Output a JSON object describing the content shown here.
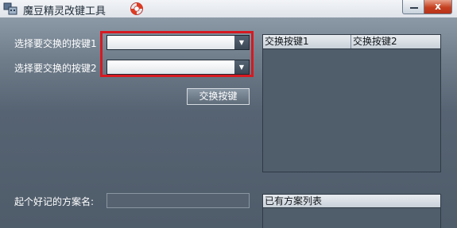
{
  "window": {
    "title": "魔豆精灵改键工具",
    "close_label": "x"
  },
  "form": {
    "key1_label": "选择要交换的按键1",
    "key1_value": "",
    "key2_label": "选择要交换的按键2",
    "key2_value": "",
    "swap_button": "交换按键",
    "scheme_name_label": "起个好记的方案名:",
    "scheme_name_value": ""
  },
  "swap_table": {
    "columns": [
      "交换按键1",
      "交换按键2"
    ],
    "rows": []
  },
  "schemes": {
    "header": "已有方案列表",
    "items": []
  },
  "colors": {
    "highlight": "#d71920",
    "background_top": "#8c99a6",
    "background_bottom": "#4f5c6a"
  },
  "icons": {
    "app": "keyboard-icon",
    "help": "lifebuoy-icon",
    "dropdown": "triangle-down-icon"
  }
}
